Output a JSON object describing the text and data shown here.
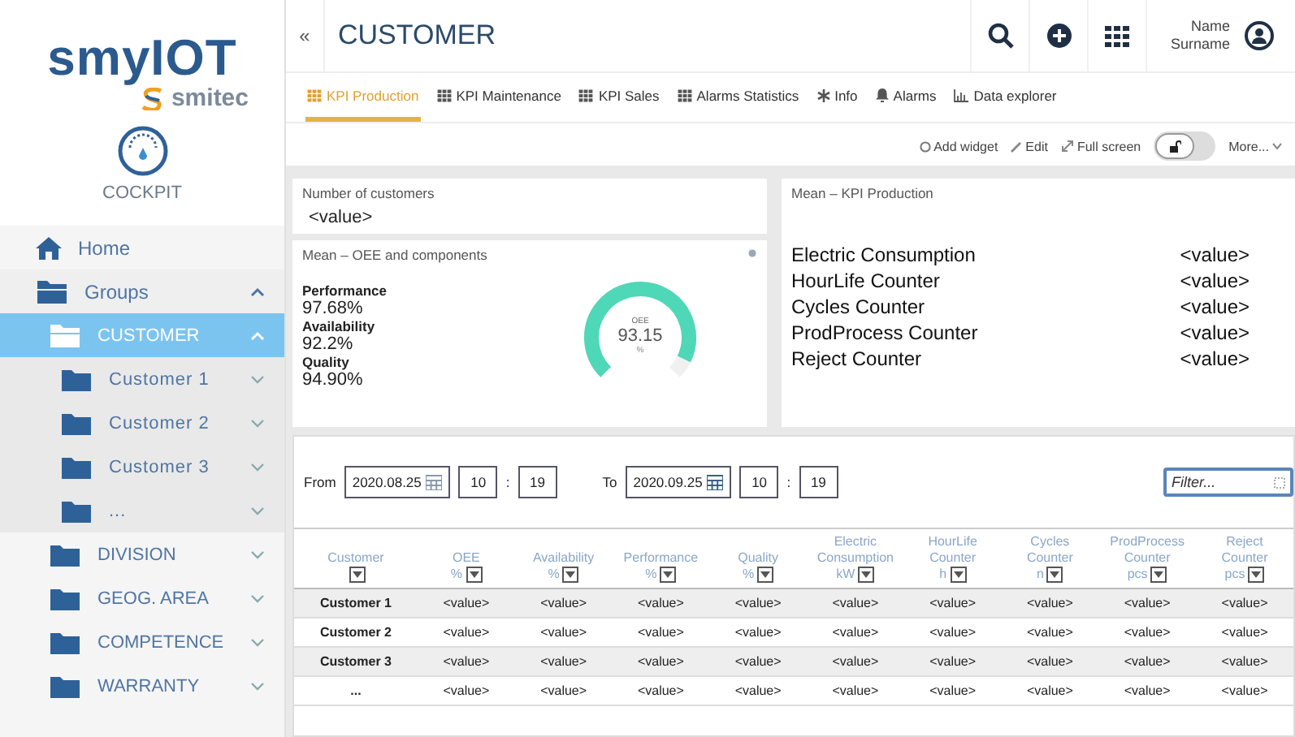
{
  "brand": {
    "name": "smyIOT",
    "maker": "smitec",
    "section": "COCKPIT"
  },
  "sidebar": {
    "items": [
      {
        "label": "Home",
        "kind": "home",
        "selected": false
      },
      {
        "label": "Groups",
        "kind": "folder",
        "selected": false,
        "expanded": true,
        "children": [
          {
            "label": "CUSTOMER",
            "kind": "folder",
            "selected": true,
            "expanded": true,
            "children": [
              {
                "label": "Customer 1",
                "kind": "folder",
                "selected": false,
                "expanded": false
              },
              {
                "label": "Customer 2",
                "kind": "folder",
                "selected": false,
                "expanded": false
              },
              {
                "label": "Customer 3",
                "kind": "folder",
                "selected": false,
                "expanded": false
              },
              {
                "label": "...",
                "kind": "folder",
                "selected": false,
                "expanded": false
              }
            ]
          },
          {
            "label": "DIVISION",
            "kind": "folder",
            "selected": false,
            "expanded": false
          },
          {
            "label": "GEOG. AREA",
            "kind": "folder",
            "selected": false,
            "expanded": false
          },
          {
            "label": "COMPETENCE",
            "kind": "folder",
            "selected": false,
            "expanded": false
          },
          {
            "label": "WARRANTY",
            "kind": "folder",
            "selected": false,
            "expanded": false
          }
        ]
      }
    ]
  },
  "header": {
    "collapse": "«",
    "title": "CUSTOMER",
    "user": {
      "name": "Name",
      "surname": "Surname"
    }
  },
  "tabs": [
    {
      "label": "KPI Production",
      "kind": "table",
      "selected": true
    },
    {
      "label": "KPI Maintenance",
      "kind": "table",
      "selected": false
    },
    {
      "label": "KPI Sales",
      "kind": "table",
      "selected": false
    },
    {
      "label": "Alarms Statistics",
      "kind": "table",
      "selected": false
    },
    {
      "label": "Info",
      "kind": "info",
      "selected": false
    },
    {
      "label": "Alarms",
      "kind": "alarm",
      "selected": false
    },
    {
      "label": "Data explorer",
      "kind": "chart",
      "selected": false
    }
  ],
  "toolbar": {
    "actions": [
      {
        "label": "Add widget",
        "kind": "add"
      },
      {
        "label": "Edit",
        "kind": "edit"
      },
      {
        "label": "Full screen",
        "kind": "fullscreen"
      }
    ],
    "lock_toggle": {
      "on": false
    },
    "more": "More..."
  },
  "widgets": {
    "customers": {
      "title": "Number of customers",
      "value": "<value>"
    },
    "oee": {
      "title": "Mean – OEE and components",
      "metrics": [
        {
          "label": "Performance",
          "value": "97.68%"
        },
        {
          "label": "Availability",
          "value": "92.2%"
        },
        {
          "label": "Quality",
          "value": "94.90%"
        }
      ],
      "gauge": {
        "label": "OEE",
        "value": "93.15",
        "unit": "%"
      }
    },
    "kpi": {
      "title": "Mean – KPI Production",
      "rows": [
        {
          "label": "Electric Consumption",
          "value": "<value>"
        },
        {
          "label": "HourLife Counter",
          "value": "<value>"
        },
        {
          "label": "Cycles Counter",
          "value": "<value>"
        },
        {
          "label": "ProdProcess Counter",
          "value": "<value>"
        },
        {
          "label": "Reject Counter",
          "value": "<value>"
        }
      ]
    }
  },
  "table": {
    "from": {
      "label": "From",
      "date": "2020.08.25",
      "hour": "10",
      "separator": ":",
      "minute": "19"
    },
    "to": {
      "label": "To",
      "date": "2020.09.25",
      "hour": "10",
      "separator": ":",
      "minute": "19"
    },
    "filter": {
      "placeholder": "Filter..."
    },
    "columns": [
      {
        "lines": [
          "Customer"
        ]
      },
      {
        "lines": [
          "OEE"
        ],
        "unit": "%"
      },
      {
        "lines": [
          "Availability"
        ],
        "unit": "%"
      },
      {
        "lines": [
          "Performance"
        ],
        "unit": "%"
      },
      {
        "lines": [
          "Quality"
        ],
        "unit": "%"
      },
      {
        "lines": [
          "Electric",
          "Consumption"
        ],
        "unit": "kW"
      },
      {
        "lines": [
          "HourLife",
          "Counter"
        ],
        "unit": "h"
      },
      {
        "lines": [
          "Cycles",
          "Counter"
        ],
        "unit": "n"
      },
      {
        "lines": [
          "ProdProcess",
          "Counter"
        ],
        "unit": "pcs"
      },
      {
        "lines": [
          "Reject",
          "Counter"
        ],
        "unit": "pcs"
      }
    ],
    "rows": [
      {
        "cells": [
          "Customer 1",
          "<value>",
          "<value>",
          "<value>",
          "<value>",
          "<value>",
          "<value>",
          "<value>",
          "<value>",
          "<value>"
        ]
      },
      {
        "cells": [
          "Customer 2",
          "<value>",
          "<value>",
          "<value>",
          "<value>",
          "<value>",
          "<value>",
          "<value>",
          "<value>",
          "<value>"
        ]
      },
      {
        "cells": [
          "Customer 3",
          "<value>",
          "<value>",
          "<value>",
          "<value>",
          "<value>",
          "<value>",
          "<value>",
          "<value>",
          "<value>"
        ]
      },
      {
        "cells": [
          "...",
          "<value>",
          "<value>",
          "<value>",
          "<value>",
          "<value>",
          "<value>",
          "<value>",
          "<value>",
          "<value>"
        ]
      }
    ]
  }
}
